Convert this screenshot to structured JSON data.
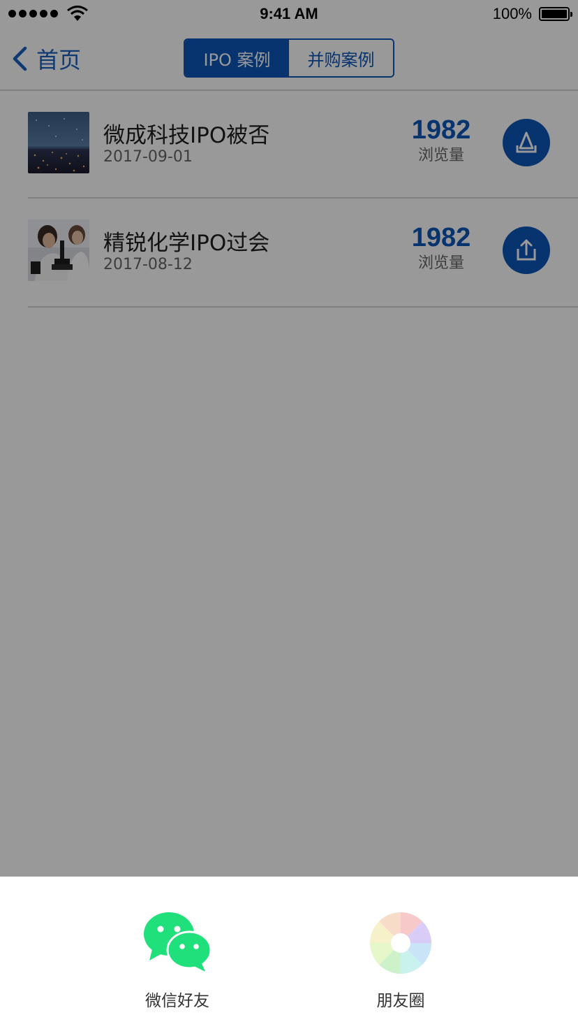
{
  "status_bar": {
    "time": "9:41 AM",
    "battery": "100%"
  },
  "nav": {
    "back_label": "首页",
    "tabs": [
      {
        "label": "IPO 案例",
        "active": true
      },
      {
        "label": "并购案例",
        "active": false
      }
    ]
  },
  "cases": [
    {
      "title": "微成科技IPO被否",
      "date": "2017-09-01",
      "views": "1982",
      "views_label": "浏览量",
      "thumbnail": "city-lights-image"
    },
    {
      "title": "精锐化学IPO过会",
      "date": "2017-08-12",
      "views": "1982",
      "views_label": "浏览量",
      "thumbnail": "scientist-microscope-image"
    }
  ],
  "share_sheet": {
    "options": [
      {
        "label": "微信好友",
        "icon": "wechat-icon"
      },
      {
        "label": "朋友圈",
        "icon": "moments-icon"
      }
    ]
  },
  "colors": {
    "accent": "#0c56b8",
    "wechat_green": "#1fe07a",
    "overlay": "rgba(0,0,0,0.40)"
  }
}
